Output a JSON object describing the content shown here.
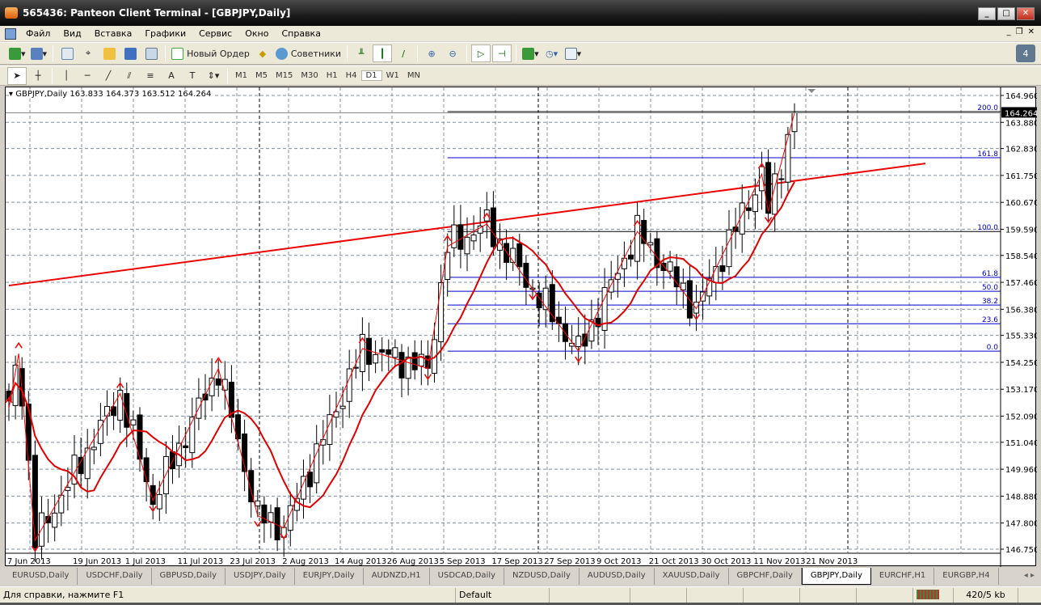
{
  "window": {
    "title": "565436: Panteon Client Terminal - [GBPJPY,Daily]",
    "buttons": [
      "_",
      "□",
      "✕"
    ]
  },
  "menu": [
    "Файл",
    "Вид",
    "Вставка",
    "Графики",
    "Сервис",
    "Окно",
    "Справка"
  ],
  "toolbar": {
    "new_order": "Новый Ордер",
    "experts": "Советники"
  },
  "timeframes": [
    "M1",
    "M5",
    "M15",
    "M30",
    "H1",
    "H4",
    "D1",
    "W1",
    "MN"
  ],
  "active_timeframe": "D1",
  "chart": {
    "legend": "GBPJPY,Daily  163.833 164.373 163.512 164.264",
    "current_price": "164.264",
    "colors": {
      "zigzag": "#ff0000",
      "ma": "#e00000",
      "trendline": "#ee0000",
      "fib": "#0000cc",
      "grid": "#8090a0"
    }
  },
  "chart_data": {
    "type": "candlestick",
    "symbol": "GBPJPY",
    "period": "Daily",
    "ylim": [
      146.75,
      164.96
    ],
    "bars": 125,
    "y_ticks": [
      "164.960",
      "163.880",
      "162.830",
      "161.750",
      "160.670",
      "159.590",
      "158.540",
      "157.460",
      "156.380",
      "155.330",
      "154.250",
      "153.170",
      "152.090",
      "151.040",
      "149.960",
      "148.880",
      "147.800",
      "146.750"
    ],
    "x_labels": [
      {
        "bar": 0,
        "label": "7 Jun 2013"
      },
      {
        "bar": 10,
        "label": "19 Jun 2013"
      },
      {
        "bar": 18,
        "label": "1 Jul 2013"
      },
      {
        "bar": 26,
        "label": "11 Jul 2013"
      },
      {
        "bar": 34,
        "label": "23 Jul 2013"
      },
      {
        "bar": 42,
        "label": "2 Aug 2013"
      },
      {
        "bar": 50,
        "label": "14 Aug 2013"
      },
      {
        "bar": 58,
        "label": "26 Aug 2013"
      },
      {
        "bar": 66,
        "label": "5 Sep 2013"
      },
      {
        "bar": 74,
        "label": "17 Sep 2013"
      },
      {
        "bar": 82,
        "label": "27 Sep 2013"
      },
      {
        "bar": 90,
        "label": "9 Oct 2013"
      },
      {
        "bar": 98,
        "label": "21 Oct 2013"
      },
      {
        "bar": 106,
        "label": "30 Oct 2013"
      },
      {
        "bar": 114,
        "label": "11 Nov 2013"
      },
      {
        "bar": 122,
        "label": "21 Nov 2013"
      }
    ],
    "zigzag_pivots": [
      [
        0,
        152.4
      ],
      [
        1.5,
        154.6
      ],
      [
        4,
        147.1
      ],
      [
        17,
        153.0
      ],
      [
        22,
        148.7
      ],
      [
        32,
        154.0
      ],
      [
        38,
        148.1
      ],
      [
        42,
        147.6
      ],
      [
        54,
        154.8
      ],
      [
        64,
        154.0
      ],
      [
        67,
        158.9
      ],
      [
        73,
        159.8
      ],
      [
        80,
        157.2
      ],
      [
        87,
        154.7
      ],
      [
        96,
        159.5
      ],
      [
        105,
        156.4
      ],
      [
        115,
        161.8
      ],
      [
        116,
        160.3
      ],
      [
        120,
        164.26
      ]
    ],
    "trendline": [
      [
        0,
        157.33
      ],
      [
        140,
        162.23
      ]
    ],
    "fib_levels": [
      {
        "label": "200.0",
        "price": 164.31
      },
      {
        "label": "161.8",
        "price": 162.46
      },
      {
        "label": "100.0",
        "price": 159.5
      },
      {
        "label": "61.8",
        "price": 157.66
      },
      {
        "label": "50.0",
        "price": 157.1
      },
      {
        "label": "38.2",
        "price": 156.55
      },
      {
        "label": "23.6",
        "price": 155.8
      },
      {
        "label": "0.0",
        "price": 154.7
      }
    ],
    "fib_start_bar": 67
  },
  "tabs": [
    "EURUSD,Daily",
    "USDCHF,Daily",
    "GBPUSD,Daily",
    "USDJPY,Daily",
    "EURJPY,Daily",
    "AUDNZD,H1",
    "USDCAD,Daily",
    "NZDUSD,Daily",
    "AUDUSD,Daily",
    "XAUUSD,Daily",
    "GBPCHF,Daily",
    "GBPJPY,Daily",
    "EURCHF,H1",
    "EURGBP,H4"
  ],
  "active_tab": "GBPJPY,Daily",
  "status": {
    "help": "Для справки, нажмите F1",
    "profile": "Default",
    "traffic": "420/5 kb"
  }
}
